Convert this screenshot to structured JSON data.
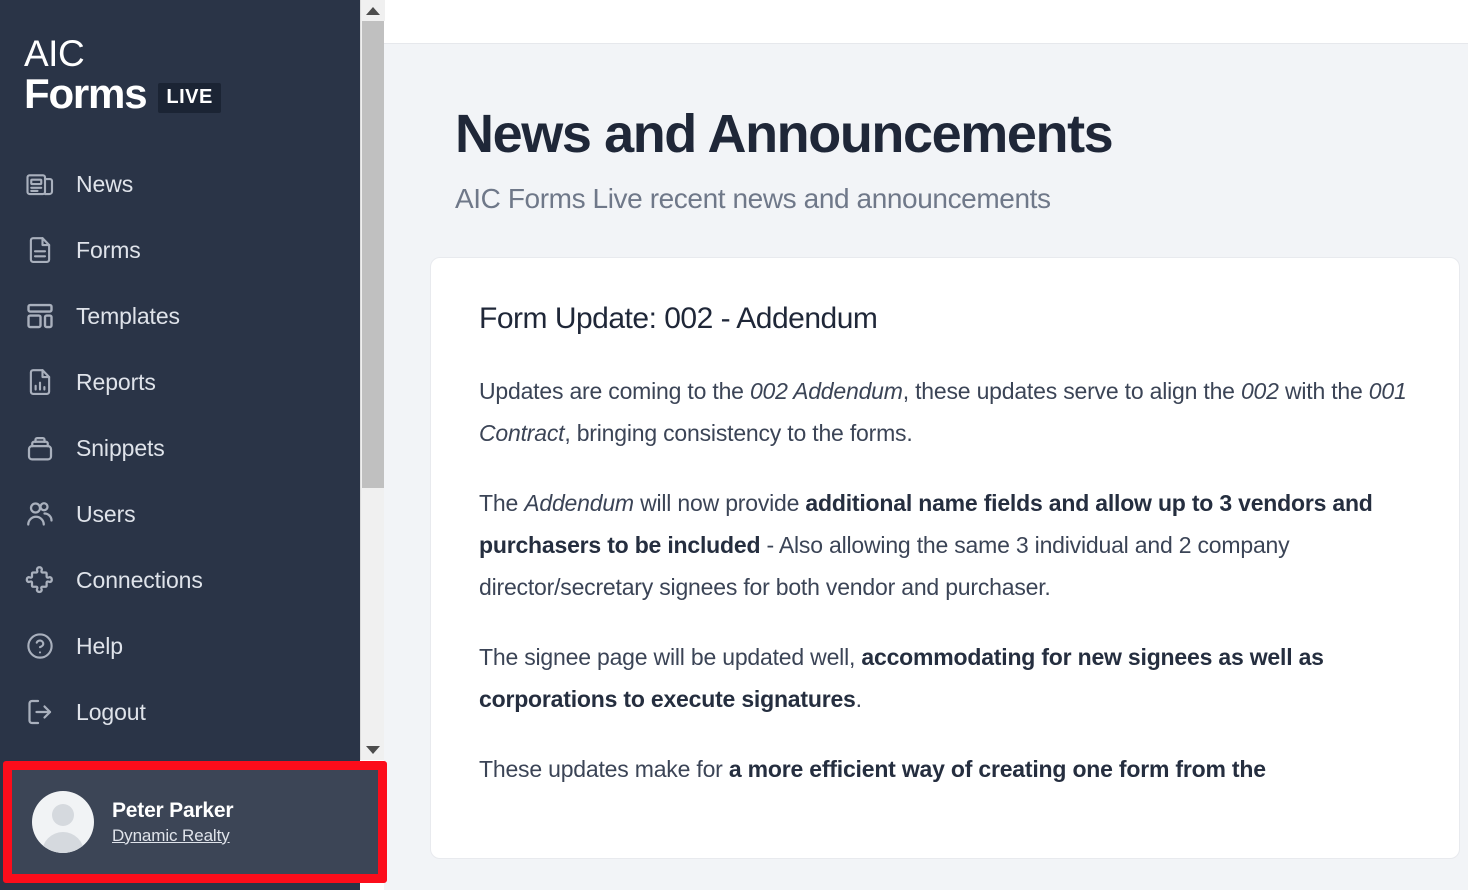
{
  "brand": {
    "line1": "AIC",
    "line2": "Forms",
    "badge": "LIVE"
  },
  "sidebar": {
    "items": [
      {
        "label": "News",
        "icon": "newspaper-icon"
      },
      {
        "label": "Forms",
        "icon": "document-icon"
      },
      {
        "label": "Templates",
        "icon": "layout-icon"
      },
      {
        "label": "Reports",
        "icon": "report-chart-icon"
      },
      {
        "label": "Snippets",
        "icon": "stack-box-icon"
      },
      {
        "label": "Users",
        "icon": "users-icon"
      },
      {
        "label": "Connections",
        "icon": "puzzle-icon"
      },
      {
        "label": "Help",
        "icon": "question-circle-icon"
      },
      {
        "label": "Logout",
        "icon": "logout-icon"
      }
    ],
    "user": {
      "name": "Peter Parker",
      "organisation": "Dynamic Realty"
    },
    "highlight_color": "#fc0d1b",
    "background_color": "#2a3447",
    "user_panel_color": "#3c4556"
  },
  "main": {
    "title": "News and Announcements",
    "subtitle": "AIC Forms Live recent news and announcements",
    "article": {
      "title": "Form Update: 002 - Addendum",
      "paragraphs": [
        [
          {
            "t": "Updates are coming to the "
          },
          {
            "t": "002 Addendum",
            "s": "i"
          },
          {
            "t": ", these updates serve to align the "
          },
          {
            "t": "002",
            "s": "i"
          },
          {
            "t": " with the "
          },
          {
            "t": "001 Contract",
            "s": "i"
          },
          {
            "t": ", bringing consistency to the forms."
          }
        ],
        [
          {
            "t": "The "
          },
          {
            "t": "Addendum",
            "s": "i"
          },
          {
            "t": " will now provide "
          },
          {
            "t": "additional name fields and allow up to 3 vendors and purchasers to be included",
            "s": "b"
          },
          {
            "t": " - Also allowing the same 3 individual and 2 company director/secretary signees for both vendor and purchaser."
          }
        ],
        [
          {
            "t": "The signee page will be updated well, "
          },
          {
            "t": "accommodating for new signees as well as corporations to execute signatures",
            "s": "b"
          },
          {
            "t": "."
          }
        ],
        [
          {
            "t": "These updates make for "
          },
          {
            "t": "a more efficient way of creating one form from the",
            "s": "b"
          }
        ]
      ]
    }
  },
  "scrollbar": {
    "up_arrow": "scroll-up-arrow",
    "down_arrow": "scroll-down-arrow"
  }
}
